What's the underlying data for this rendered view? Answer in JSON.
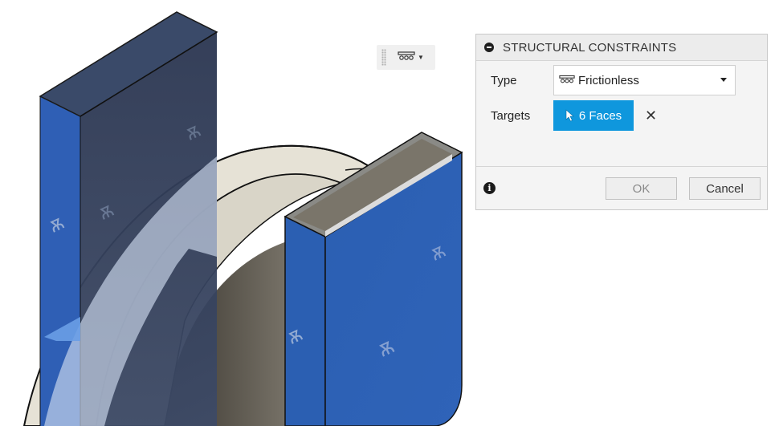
{
  "viewport": {
    "toolbar": {
      "icon": "frictionless-constraint-icon"
    }
  },
  "dialog": {
    "title": "STRUCTURAL CONSTRAINTS",
    "type_label": "Type",
    "type_value": "Frictionless",
    "type_icon": "frictionless-constraint-icon",
    "targets_label": "Targets",
    "targets_value": "6 Faces",
    "targets_icon": "cursor-icon",
    "clear_icon": "close-icon",
    "ok_label": "OK",
    "cancel_label": "Cancel",
    "info_icon": "info-icon"
  },
  "colors": {
    "selected_face": "#2e5fb0",
    "targets_button": "#0f97dd",
    "ring": "#e6e2d6"
  }
}
